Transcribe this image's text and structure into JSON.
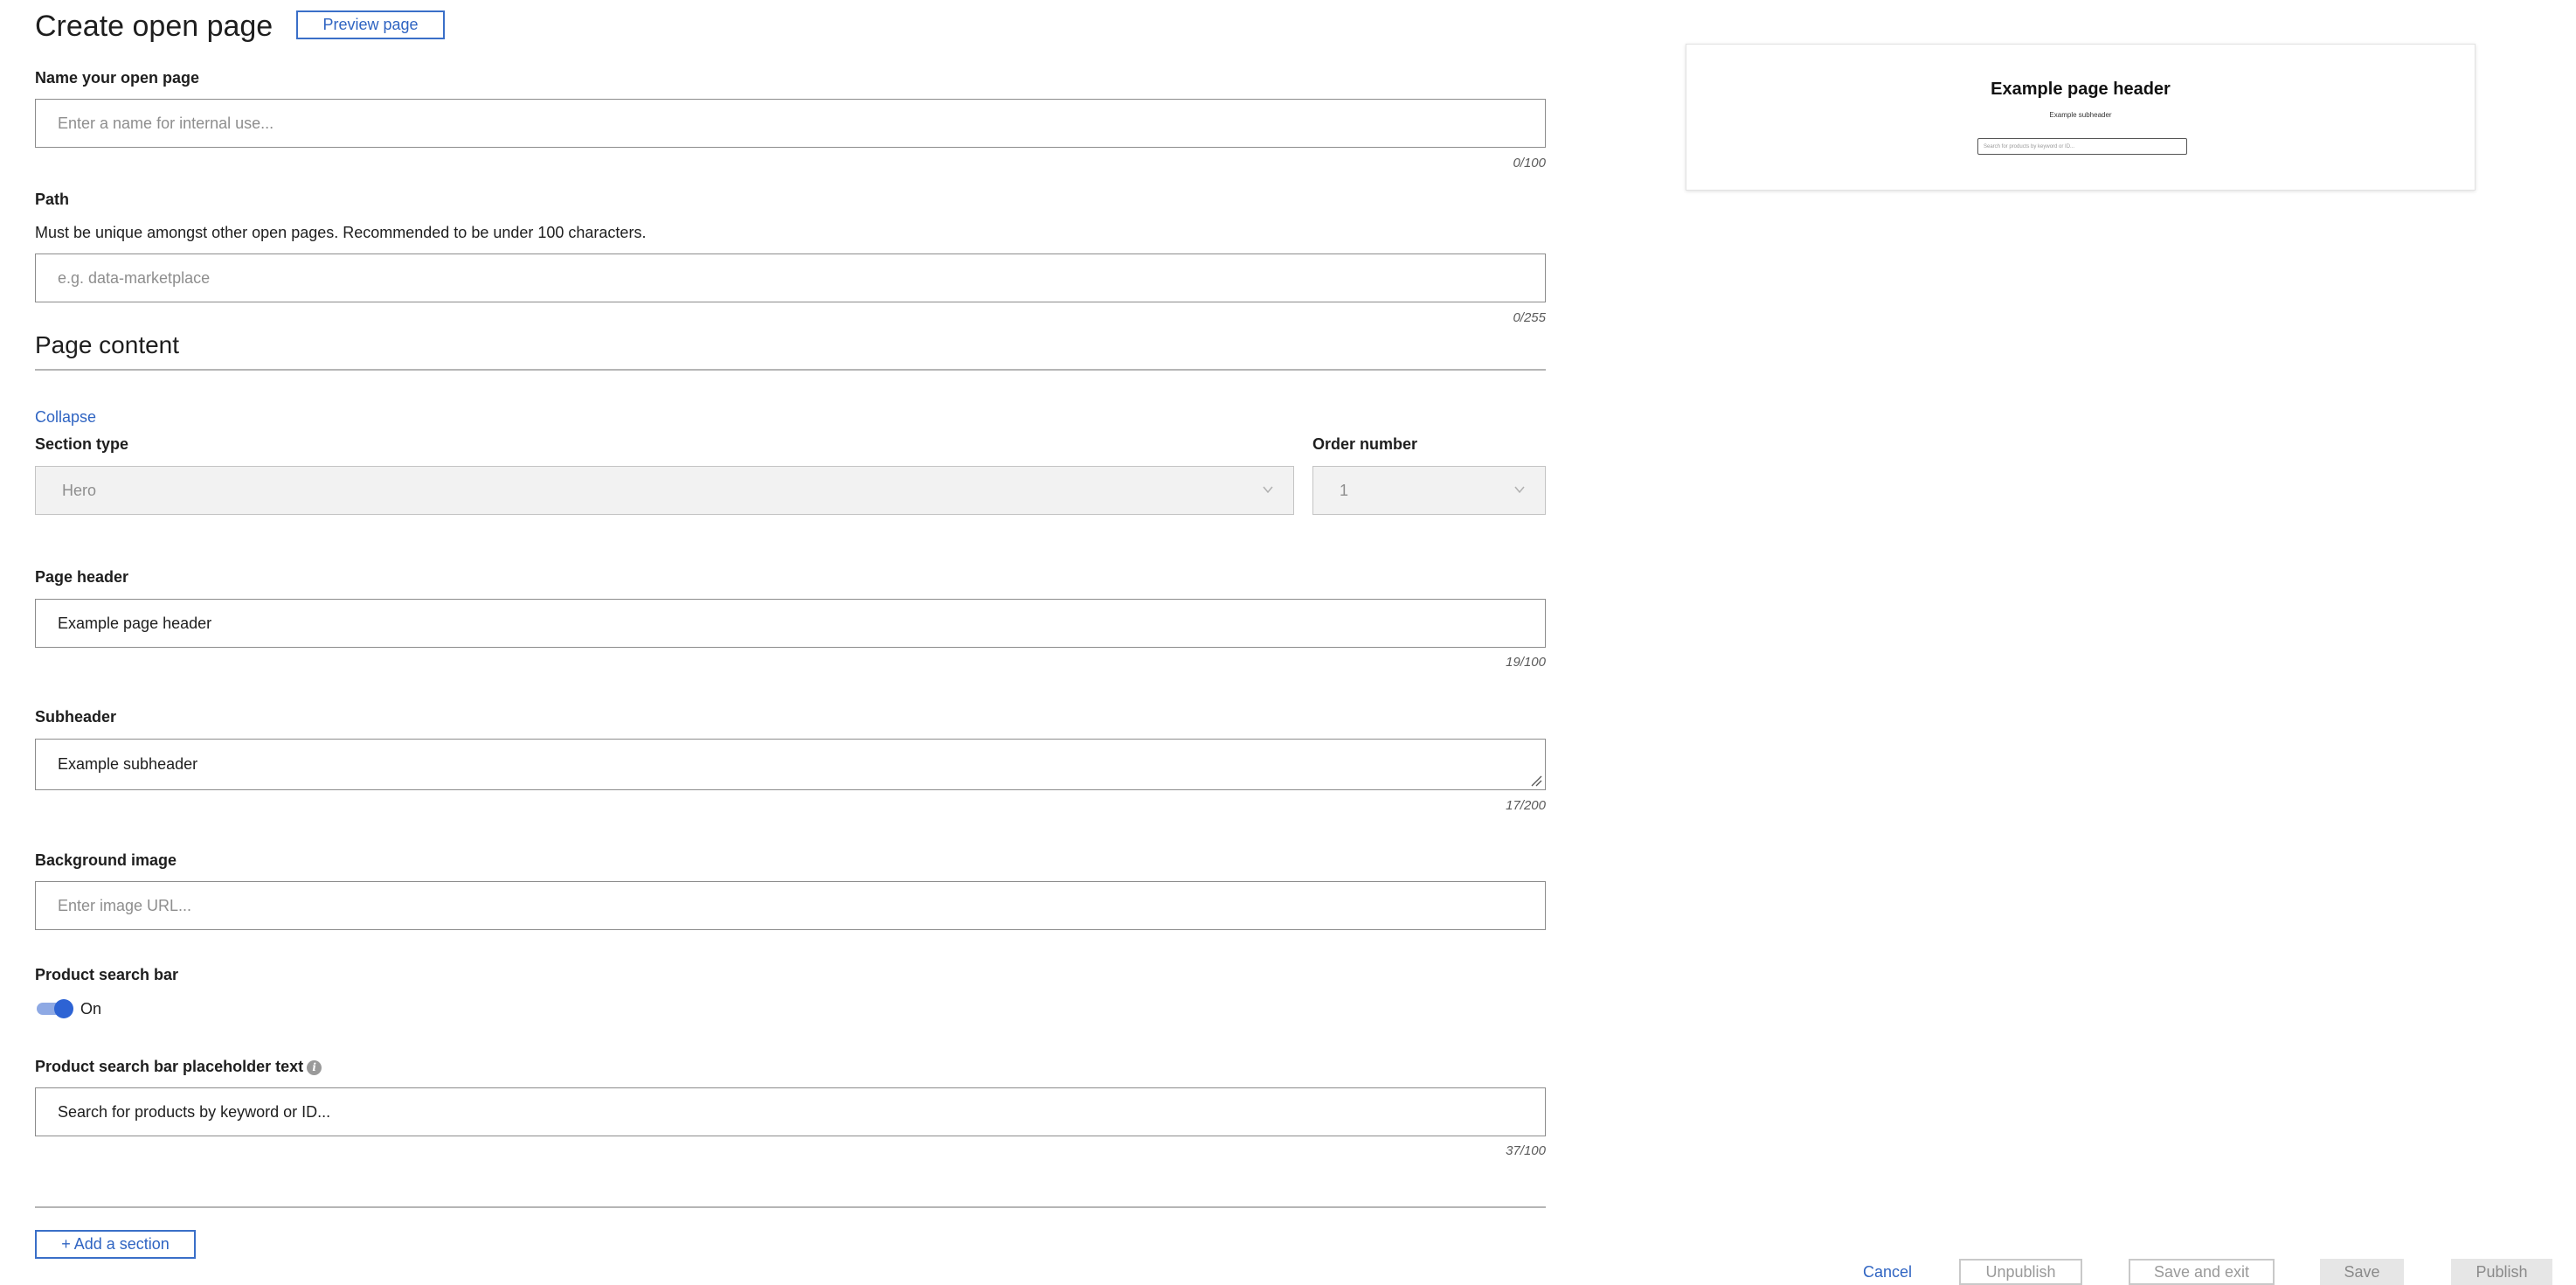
{
  "header": {
    "title": "Create open page",
    "preview_button": "Preview page"
  },
  "name_field": {
    "label": "Name your open page",
    "placeholder": "Enter a name for internal use...",
    "counter": "0/100"
  },
  "path_field": {
    "label": "Path",
    "helper": "Must be unique amongst other open pages. Recommended to be under 100 characters.",
    "placeholder": "e.g. data-marketplace",
    "counter": "0/255"
  },
  "page_content": {
    "title": "Page content",
    "collapse_link": "Collapse",
    "section_type": {
      "label": "Section type",
      "value": "Hero"
    },
    "order_number": {
      "label": "Order number",
      "value": "1"
    },
    "page_header": {
      "label": "Page header",
      "value": "Example page header",
      "counter": "19/100"
    },
    "subheader": {
      "label": "Subheader",
      "value": "Example subheader",
      "counter": "17/200"
    },
    "background_image": {
      "label": "Background image",
      "placeholder": "Enter image URL..."
    },
    "product_search_bar": {
      "label": "Product search bar",
      "toggle_state": "On",
      "enabled": true
    },
    "search_placeholder": {
      "label": "Product search bar placeholder text",
      "value": "Search for products by keyword or ID...",
      "counter": "37/100"
    },
    "add_section_button": "+ Add a section"
  },
  "preview": {
    "header": "Example page header",
    "subheader": "Example subheader",
    "search_placeholder": "Search for products by keyword or ID..."
  },
  "footer": {
    "cancel": "Cancel",
    "unpublish": "Unpublish",
    "save_and_exit": "Save and exit",
    "save": "Save",
    "publish": "Publish"
  },
  "colors": {
    "accent": "#2f64c2",
    "toggle_on": "#2d63d4",
    "disabled_bg": "#e6e6e6"
  }
}
